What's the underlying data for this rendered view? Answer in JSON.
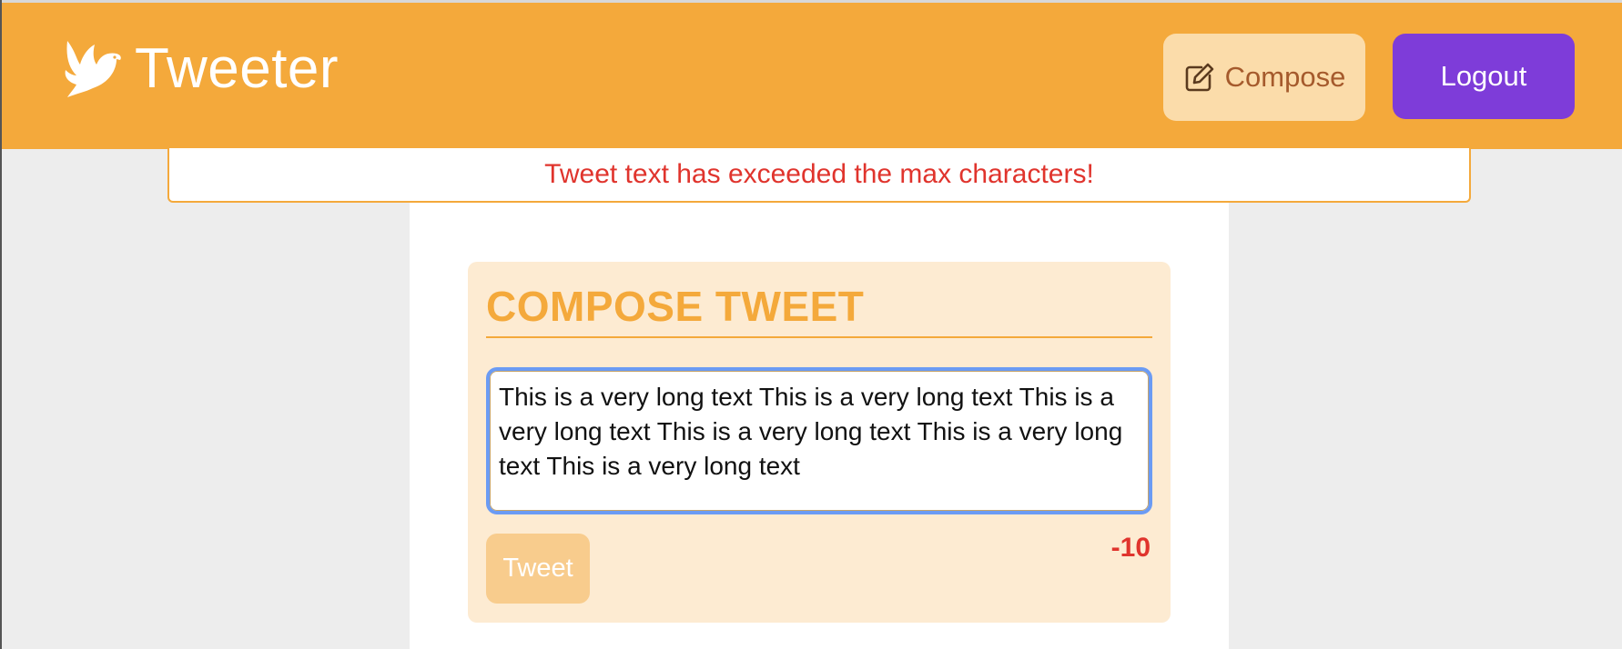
{
  "header": {
    "app_name": "Tweeter",
    "logo_icon": "dove-icon",
    "compose_label": "Compose",
    "compose_icon": "edit-icon",
    "logout_label": "Logout",
    "colors": {
      "header_bg": "#f4a93b",
      "compose_bg": "#fbdcaa",
      "logout_bg": "#7e3cd9"
    }
  },
  "alert": {
    "message": "Tweet text has exceeded the max characters!",
    "color": "#e0342d"
  },
  "compose": {
    "title": "COMPOSE TWEET",
    "text_value": "This is a very long text This is a very long text This is a very long text This is a very long text This is a very long text This is a very long text ",
    "tweet_label": "Tweet",
    "char_counter": "-10"
  }
}
